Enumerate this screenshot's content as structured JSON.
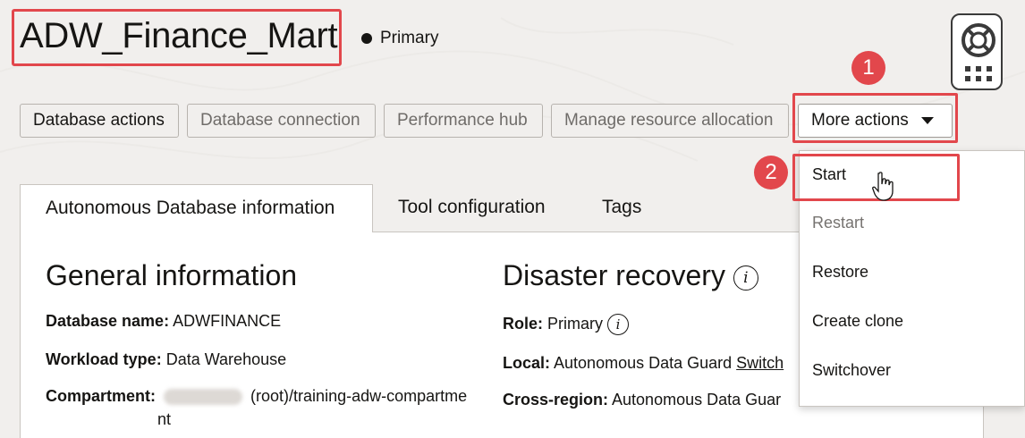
{
  "header": {
    "title": "ADW_Finance_Mart",
    "status": "Primary"
  },
  "toolbar": {
    "database_actions": "Database actions",
    "database_connection": "Database connection",
    "performance_hub": "Performance hub",
    "manage_resource_allocation": "Manage resource allocation",
    "more_actions": "More actions"
  },
  "callouts": {
    "one": "1",
    "two": "2"
  },
  "tabs": {
    "info": "Autonomous Database information",
    "tool": "Tool configuration",
    "tags": "Tags"
  },
  "general": {
    "heading": "General information",
    "db_name_label": "Database name:",
    "db_name_value": "ADWFINANCE",
    "workload_label": "Workload type:",
    "workload_value": "Data Warehouse",
    "compartment_label": "Compartment:",
    "compartment_value": "(root)/training-adw-compartme",
    "compartment_wrap": "nt"
  },
  "disaster": {
    "heading": "Disaster recovery",
    "role_label": "Role:",
    "role_value": "Primary",
    "local_label": "Local:",
    "local_value": "Autonomous Data Guard",
    "local_link": "Switch",
    "cross_label": "Cross-region:",
    "cross_value": "Autonomous Data Guar"
  },
  "menu": {
    "start": "Start",
    "restart": "Restart",
    "restore": "Restore",
    "create_clone": "Create clone",
    "switchover": "Switchover"
  },
  "colors": {
    "callout": "#e2474c",
    "accent_teal": "#1f5d6b",
    "background": "#f1efed"
  }
}
